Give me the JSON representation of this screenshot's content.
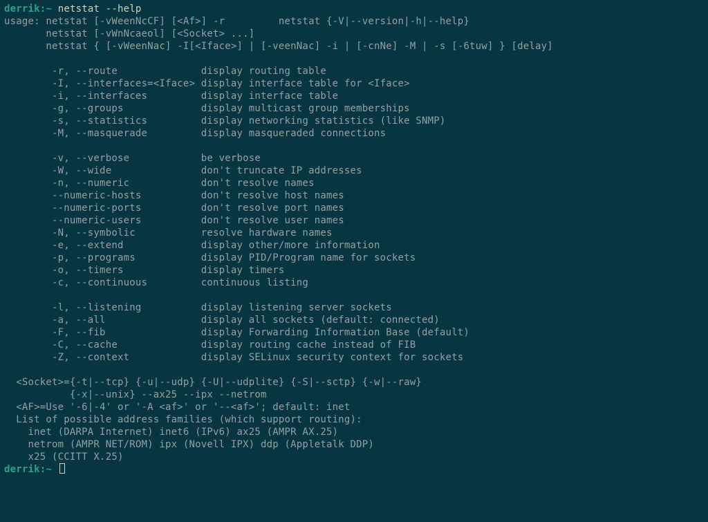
{
  "prompt": {
    "user": "derrik",
    "sep": ":",
    "path": "~",
    "sigil": " "
  },
  "command": "netstat --help",
  "output": {
    "usage": [
      "usage: netstat [-vWeenNcCF] [<Af>] -r         netstat {-V|--version|-h|--help}",
      "       netstat [-vWnNcaeol] [<Socket> ...]",
      "       netstat { [-vWeenNac] -I[<Iface>] | [-veenNac] -i | [-cnNe] -M | -s [-6tuw] } [delay]"
    ],
    "opts1": [
      [
        "-r, --route",
        "display routing table"
      ],
      [
        "-I, --interfaces=<Iface>",
        "display interface table for <Iface>"
      ],
      [
        "-i, --interfaces",
        "display interface table"
      ],
      [
        "-g, --groups",
        "display multicast group memberships"
      ],
      [
        "-s, --statistics",
        "display networking statistics (like SNMP)"
      ],
      [
        "-M, --masquerade",
        "display masqueraded connections"
      ]
    ],
    "opts2": [
      [
        "-v, --verbose",
        "be verbose"
      ],
      [
        "-W, --wide",
        "don't truncate IP addresses"
      ],
      [
        "-n, --numeric",
        "don't resolve names"
      ],
      [
        "--numeric-hosts",
        "don't resolve host names"
      ],
      [
        "--numeric-ports",
        "don't resolve port names"
      ],
      [
        "--numeric-users",
        "don't resolve user names"
      ],
      [
        "-N, --symbolic",
        "resolve hardware names"
      ],
      [
        "-e, --extend",
        "display other/more information"
      ],
      [
        "-p, --programs",
        "display PID/Program name for sockets"
      ],
      [
        "-o, --timers",
        "display timers"
      ],
      [
        "-c, --continuous",
        "continuous listing"
      ]
    ],
    "opts3": [
      [
        "-l, --listening",
        "display listening server sockets"
      ],
      [
        "-a, --all",
        "display all sockets (default: connected)"
      ],
      [
        "-F, --fib",
        "display Forwarding Information Base (default)"
      ],
      [
        "-C, --cache",
        "display routing cache instead of FIB"
      ],
      [
        "-Z, --context",
        "display SELinux security context for sockets"
      ]
    ],
    "footer": [
      "  <Socket>={-t|--tcp} {-u|--udp} {-U|--udplite} {-S|--sctp} {-w|--raw}",
      "           {-x|--unix} --ax25 --ipx --netrom",
      "  <AF>=Use '-6|-4' or '-A <af>' or '--<af>'; default: inet",
      "  List of possible address families (which support routing):",
      "    inet (DARPA Internet) inet6 (IPv6) ax25 (AMPR AX.25)",
      "    netrom (AMPR NET/ROM) ipx (Novell IPX) ddp (Appletalk DDP)",
      "    x25 (CCITT X.25)"
    ]
  }
}
